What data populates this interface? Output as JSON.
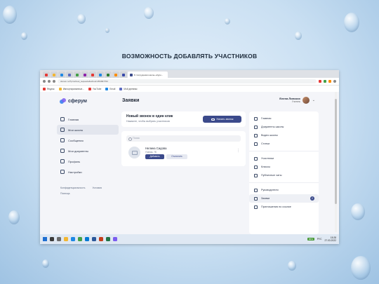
{
  "slide": {
    "title": "ВОЗМОЖНОСТЬ ДОБАВЛЯТЬ УЧАСТНИКОВ"
  },
  "browser": {
    "active_tab_title": "8. Сотрудники школы «Куро...",
    "url": "sferum.ru/?p=school_requests&school=254997762",
    "bookmarks": [
      {
        "label": "Яндекс",
        "color": "#e53935"
      },
      {
        "label": "Импортированные...",
        "color": "#f2b632"
      },
      {
        "label": "YouTube",
        "color": "#e53935"
      },
      {
        "label": "Email",
        "color": "#1e88e5"
      },
      {
        "label": "Мой дневник",
        "color": "#5c6bc0"
      }
    ]
  },
  "app": {
    "logo": "сферум",
    "page_title": "Заявки",
    "user": {
      "name": "Елена Липских",
      "role": "Учитель"
    },
    "sidebar": {
      "items": [
        {
          "label": "Главная",
          "icon": "home-icon"
        },
        {
          "label": "Мои школы",
          "icon": "school-icon"
        },
        {
          "label": "Сообщения",
          "icon": "message-icon"
        },
        {
          "label": "Мои документы",
          "icon": "documents-icon"
        },
        {
          "label": "Профиль",
          "icon": "profile-icon"
        },
        {
          "label": "Настройки",
          "icon": "settings-icon"
        }
      ],
      "footer_links": [
        "Конфиденциальность",
        "Условия",
        "Помощь"
      ]
    },
    "call": {
      "title": "Новый звонок в один клик",
      "subtitle": "Нажмите, чтобы выбрать участников",
      "button": "Начать звонок"
    },
    "requests": {
      "search_placeholder": "Поиск",
      "person": {
        "name": "Нелина Сидова",
        "role": "Ученик, 7Б"
      },
      "add_button": "Добавить",
      "reject_button": "Отклонить"
    },
    "right_menu": {
      "groups": [
        [
          {
            "label": "Главная",
            "icon": "home-icon"
          },
          {
            "label": "Документы школы",
            "icon": "documents-icon"
          },
          {
            "label": "Видео школы",
            "icon": "video-icon"
          },
          {
            "label": "Статьи",
            "icon": "article-icon"
          }
        ],
        [
          {
            "label": "Участники",
            "icon": "members-icon"
          },
          {
            "label": "Классы",
            "icon": "classes-icon"
          },
          {
            "label": "Публичные чаты",
            "icon": "chat-icon"
          }
        ],
        [
          {
            "label": "Руководители",
            "icon": "leaders-icon"
          },
          {
            "label": "Заявки",
            "icon": "requests-icon",
            "badge": "2"
          },
          {
            "label": "Приглашения по ссылке",
            "icon": "link-icon"
          }
        ]
      ]
    }
  },
  "taskbar": {
    "battery": "95%",
    "lang": "РУС",
    "time": "15:28",
    "date": "27.03.2022"
  }
}
